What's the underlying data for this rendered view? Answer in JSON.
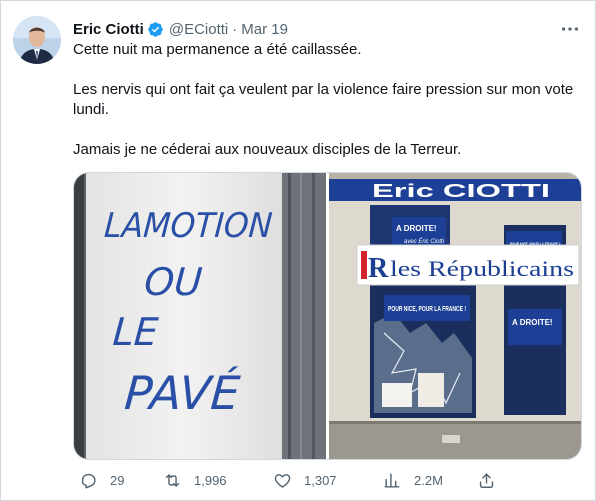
{
  "author": {
    "name": "Eric Ciotti",
    "handle": "@ECiotti",
    "separator": "·",
    "date": "Mar 19"
  },
  "tweet": {
    "paragraphs": [
      "Cette nuit ma permanence a été caillassée.",
      "Les nervis qui ont fait ça veulent par la violence faire pression sur mon vote lundi.",
      "Jamais je ne céderai aux nouveaux disciples de la Terreur."
    ]
  },
  "media": {
    "left_graffiti": [
      "LAMOTION",
      "OU",
      "LE",
      "PAVÉ"
    ],
    "storefront_sign": "Eric CIOTTI",
    "banner_logo": "R",
    "banner_text": "les Républicains",
    "poster_a_droite": "A DROITE!",
    "poster_a_droite_sub": "avec Éric Ciotti",
    "poster_pour_nice": "POUR NICE, POUR LA FRANCE !"
  },
  "actions": {
    "replies": "29",
    "retweets": "1,996",
    "likes": "1,307",
    "views": "2.2M"
  },
  "colors": {
    "verified": "#1d9bf0",
    "secondary_text": "#536471",
    "border": "#cfd9de",
    "ink_blue": "#2a4fa6",
    "lr_red": "#d2232a",
    "lr_blue": "#1c3f94"
  },
  "icons": {
    "verified": "verified-badge-icon",
    "more": "more-icon",
    "reply": "reply-icon",
    "retweet": "retweet-icon",
    "like": "like-icon",
    "views": "views-icon",
    "share": "share-icon"
  }
}
